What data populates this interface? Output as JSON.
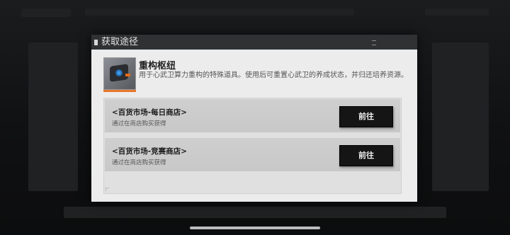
{
  "dialog": {
    "title": "获取途径",
    "item": {
      "name": "重构枢纽",
      "description": "用于心武卫算力重构的特殊道具。使用后可重置心武卫的养成状态，并归还培养资源。"
    },
    "sources": [
      {
        "name": "<百货市场-每日商店>",
        "detail": "通过在商店购买获得",
        "button_label": "前往"
      },
      {
        "name": "<百货市场-竞赛商店>",
        "detail": "通过在商店购买获得",
        "button_label": "前往"
      }
    ]
  },
  "colors": {
    "title_bar": "#2f3133",
    "panel": "#ececec",
    "button": "#151515",
    "accent": "#e8782a"
  }
}
